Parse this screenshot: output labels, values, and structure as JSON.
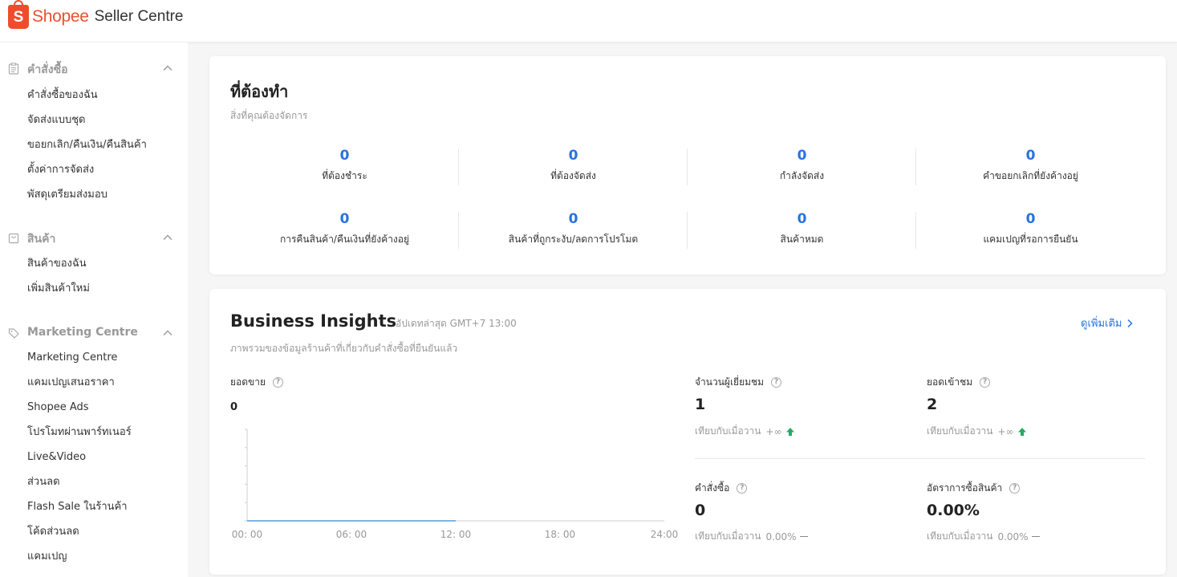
{
  "header": {
    "brand": "Shopee",
    "portal": "Seller Centre",
    "logo_letter": "S"
  },
  "colors": {
    "brand": "#ee4d2d",
    "link": "#2673dd",
    "up": "#26aa62"
  },
  "sidebar": [
    {
      "title": "คำสั่งซื้อ",
      "icon": "clipboard-icon",
      "items": [
        "คำสั่งซื้อของฉัน",
        "จัดส่งแบบชุด",
        "ขอยกเลิก/คืนเงิน/คืนสินค้า",
        "ตั้งค่าการจัดส่ง",
        "พัสดุเตรียมส่งมอบ"
      ]
    },
    {
      "title": "สินค้า",
      "icon": "bag-icon",
      "items": [
        "สินค้าของฉัน",
        "เพิ่มสินค้าใหม่"
      ]
    },
    {
      "title": "Marketing Centre",
      "icon": "tag-icon",
      "items": [
        "Marketing Centre",
        "แคมเปญเสนอราคา",
        "Shopee Ads",
        "โปรโมทผ่านพาร์ทเนอร์",
        "Live&Video",
        "ส่วนลด",
        "Flash Sale ในร้านค้า",
        "โค้ดส่วนลด",
        "แคมเปญ"
      ]
    }
  ],
  "todo": {
    "title": "ที่ต้องทำ",
    "subtitle": "สิ่งที่คุณต้องจัดการ",
    "cells": [
      {
        "value": "0",
        "label": "ที่ต้องชำระ"
      },
      {
        "value": "0",
        "label": "ที่ต้องจัดส่ง"
      },
      {
        "value": "0",
        "label": "กำลังจัดส่ง"
      },
      {
        "value": "0",
        "label": "คำขอยกเลิกที่ยังค้างอยู่"
      },
      {
        "value": "0",
        "label": "การคืนสินค้า/คืนเงินที่ยังค้างอยู่"
      },
      {
        "value": "0",
        "label": "สินค้าที่ถูกระงับ/ลดการโปรโมต"
      },
      {
        "value": "0",
        "label": "สินค้าหมด"
      },
      {
        "value": "0",
        "label": "แคมเปญที่รอการยืนยัน"
      }
    ]
  },
  "insights": {
    "title": "Business Insights",
    "updated": "อัปเดทล่าสุด GMT+7 13:00",
    "more": "ดูเพิ่มเติม",
    "subtitle": "ภาพรวมของข้อมูลร้านค้าที่เกี่ยวกับคำสั่งซื้อที่ยืนยันแล้ว",
    "sales_label": "ยอดขาย",
    "sales_value": "0",
    "metrics": [
      {
        "label": "จำนวนผู้เยี่ยมชม",
        "value": "1",
        "compare": "เทียบกับเมื่อวาน",
        "change": "+∞",
        "trend": "up"
      },
      {
        "label": "ยอดเข้าชม",
        "value": "2",
        "compare": "เทียบกับเมื่อวาน",
        "change": "+∞",
        "trend": "up"
      },
      {
        "label": "คำสั่งซื้อ",
        "value": "0",
        "compare": "เทียบกับเมื่อวาน",
        "change": "0.00%",
        "trend": "flat"
      },
      {
        "label": "อัตราการซื้อสินค้า",
        "value": "0.00%",
        "compare": "เทียบกับเมื่อวาน",
        "change": "0.00%",
        "trend": "flat"
      }
    ]
  },
  "chart_data": {
    "type": "line",
    "x_ticks": [
      "00: 00",
      "06: 00",
      "12: 00",
      "18: 00",
      "24:00"
    ],
    "x": [
      0,
      1,
      2,
      3,
      4,
      5,
      6,
      7,
      8,
      9,
      10,
      11,
      12
    ],
    "series": [
      {
        "values": [
          0,
          0,
          0,
          0,
          0,
          0,
          0,
          0,
          0,
          0,
          0,
          0,
          0
        ]
      }
    ],
    "xlim": [
      0,
      24
    ],
    "ylim": [
      0,
      1
    ]
  }
}
